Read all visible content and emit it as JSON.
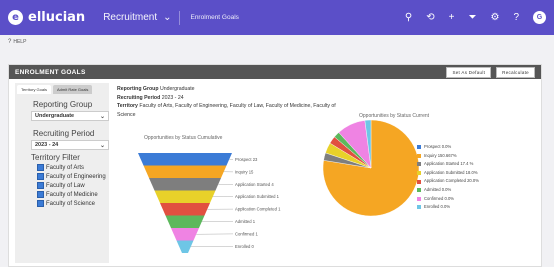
{
  "topbar": {
    "brand": "ellucian",
    "module": "Recruitment",
    "page": "Enrolment Goals",
    "avatar_initial": "G"
  },
  "help": {
    "label": "HELP"
  },
  "card": {
    "title": "ENROLMENT GOALS",
    "btn_default": "Set As Default",
    "btn_refresh": "Recalculate"
  },
  "filters": {
    "tabs": [
      "Territory Goals",
      "Admit Rate Goals"
    ],
    "reporting_group_label": "Reporting Group",
    "reporting_group_value": "Undergraduate",
    "recruiting_period_label": "Recruiting Period",
    "recruiting_period_value": "2023 - 24",
    "territory_filter_label": "Territory Filter",
    "territories": [
      "Faculty of Arts",
      "Faculty of Engineering",
      "Faculty of Law",
      "Faculty of Medicine",
      "Faculty of Science"
    ]
  },
  "summary": {
    "rg_label": "Reporting Group",
    "rg_value": "Undergraduate",
    "rp_label": "Recruiting Period",
    "rp_value": "2023 - 24",
    "territory_label": "Territory",
    "territory_value": "Faculty of Arts, Faculty of Engineering, Faculty of Law, Faculty of Medicine, Faculty of Science"
  },
  "colors": {
    "accent": "#5b4fc8",
    "header": "#555555"
  },
  "chart_data": [
    {
      "type": "funnel",
      "title": "Opportunities by Status Cumulative",
      "categories": [
        "Prospect 23",
        "Inquiry 15",
        "Application Started 4",
        "Application Submitted 1",
        "Application Completed 1",
        "Admitted 1",
        "Confirmed 1",
        "Enrolled 0"
      ],
      "colors": [
        "#3b7bd6",
        "#f5a623",
        "#7e7e7e",
        "#e8d12a",
        "#e15040",
        "#5cb85c",
        "#ef83e3",
        "#6ec6e6"
      ]
    },
    {
      "type": "pie",
      "title": "Opportunities by Status Current",
      "series": [
        {
          "label": "Prospect 0.0%",
          "value": 0.0,
          "color": "#3b7bd6"
        },
        {
          "label": "Inquiry 150.667%",
          "value": 76.0,
          "color": "#f5a623"
        },
        {
          "label": "Application Started 17.4 %",
          "value": 2.5,
          "color": "#7e7e7e"
        },
        {
          "label": "Application Submitted 18.0%",
          "value": 3.5,
          "color": "#e8d12a"
        },
        {
          "label": "Application Completed 20.0%",
          "value": 2.5,
          "color": "#e15040"
        },
        {
          "label": "Admitted 0.0%",
          "value": 2.0,
          "color": "#5cb85c"
        },
        {
          "label": "Confirmed 0.0%",
          "value": 9.5,
          "color": "#ef83e3"
        },
        {
          "label": "Enrolled 0.0%",
          "value": 2.0,
          "color": "#6ec6e6"
        }
      ]
    }
  ]
}
